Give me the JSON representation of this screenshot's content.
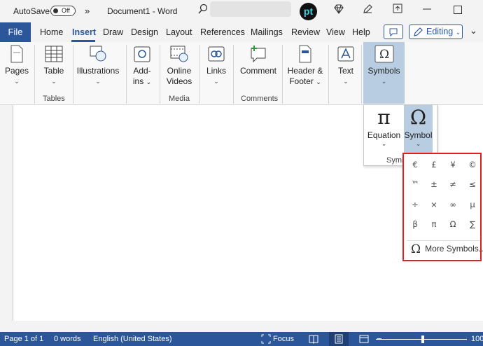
{
  "titlebar": {
    "autosave_label": "AutoSave",
    "autosave_state": "Off",
    "overflow": "»",
    "doc_title": "Document1  -  Word",
    "logo_text": "pt"
  },
  "tabs": {
    "file": "File",
    "items": [
      "Home",
      "Insert",
      "Draw",
      "Design",
      "Layout",
      "References",
      "Mailings",
      "Review",
      "View",
      "Help"
    ],
    "active": "Insert",
    "editing_label": "Editing",
    "more": "⌄"
  },
  "ribbon": {
    "pages": "Pages",
    "table": "Table",
    "illustrations": "Illustrations",
    "addins_1": "Add-",
    "addins_2": "ins",
    "online_1": "Online",
    "online_2": "Videos",
    "links": "Links",
    "comment": "Comment",
    "header_1": "Header &",
    "header_2": "Footer",
    "text": "Text",
    "symbols": "Symbols",
    "groups": {
      "tables": "Tables",
      "media": "Media",
      "comments": "Comments"
    }
  },
  "symbols_dropdown": {
    "equation": "Equation",
    "symbol": "Symbol",
    "group": "Symb",
    "pi": "π",
    "omega": "Ω"
  },
  "symbol_panel": {
    "symbols": [
      "€",
      "£",
      "¥",
      "©",
      "™",
      "±",
      "≠",
      "≤",
      "÷",
      "×",
      "∞",
      "µ",
      "β",
      "π",
      "Ω",
      "∑"
    ],
    "more": "More Symbols..."
  },
  "status": {
    "page": "Page 1 of 1",
    "words": "0 words",
    "language": "English (United States)",
    "focus": "Focus",
    "zoom": "100"
  },
  "colors": {
    "brand": "#2b579a",
    "highlight": "#b9cde2",
    "panel_border": "#e02020"
  }
}
